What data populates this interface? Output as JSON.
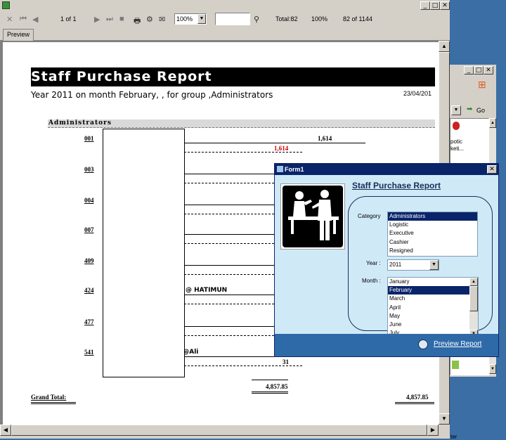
{
  "viewer": {
    "tab_preview": "Preview",
    "page_indicator": "1 of 1",
    "zoom": "100%",
    "search_value": "",
    "total": "Total:82",
    "percent": "100%",
    "records": "82 of 1144"
  },
  "report": {
    "title": "Staff Purchase Report",
    "subtitle": "Year 2011 on month February,  , for group ,Administrators",
    "date": "23/04/201",
    "group_label": "Administrators",
    "rows": [
      {
        "code": "001",
        "value": "1,614",
        "subtotal": "1,614",
        "name": ""
      },
      {
        "code": "003",
        "value": "",
        "subtotal": "",
        "name": ""
      },
      {
        "code": "004",
        "value": "",
        "subtotal": "",
        "name": ""
      },
      {
        "code": "007",
        "value": "",
        "subtotal": "",
        "name": ""
      },
      {
        "code": "409",
        "value": "",
        "subtotal": "",
        "name": ""
      },
      {
        "code": "424",
        "value": "",
        "subtotal": "",
        "name": "@ HATIMUN"
      },
      {
        "code": "477",
        "value": "",
        "subtotal": "",
        "name": ""
      },
      {
        "code": "541",
        "value": "",
        "subtotal": "31",
        "name": "ali@Ali"
      }
    ],
    "group_total": "4,857.85",
    "grand_total_label": "Grand Total:",
    "grand_total": "4,857.85"
  },
  "bgwin": {
    "go_label": "Go",
    "text1": "potic",
    "text2": "keti...",
    "text3": "ter"
  },
  "form1": {
    "title": "Form1",
    "heading": "Staff Purchase Report",
    "category_label": "Category",
    "categories": [
      "Administrators",
      "Logistic",
      "Executive",
      "Cashier",
      "Resigned"
    ],
    "category_selected": 0,
    "year_label": "Year :",
    "year_value": "2011",
    "month_label": "Month :",
    "months": [
      "January",
      "February",
      "March",
      "April",
      "May",
      "June",
      "July"
    ],
    "month_selected": 1,
    "preview_link": "Preview Report"
  },
  "colors": {
    "form_body": "#cfe9f7",
    "form_footer": "#2e6aa8",
    "title_bar": "#0a246a",
    "subtotal_red": "#cc0000",
    "desktop": "#3a6ea5"
  }
}
